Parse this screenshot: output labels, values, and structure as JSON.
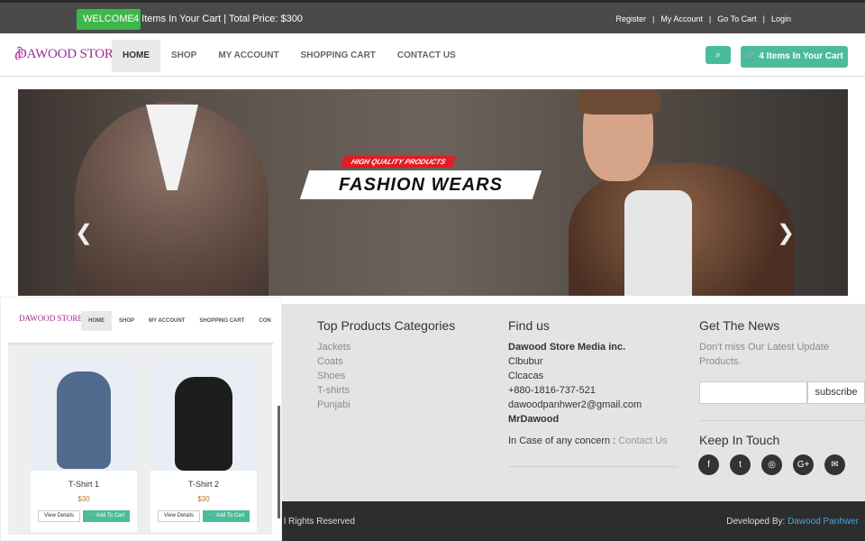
{
  "topbar": {
    "welcome": "WELCOME",
    "cart_summary": "4 Items In Your Cart | Total Price: $300",
    "links": [
      "Register",
      "My Account",
      "Go To Cart",
      "Login"
    ]
  },
  "logo": "DAWOOD STORE",
  "nav": [
    "HOME",
    "SHOP",
    "MY ACCOUNT",
    "SHOPPING CART",
    "CONTACT US"
  ],
  "header_cart": "4 Items In Your Cart",
  "hero": {
    "tag": "HIGH QUALITY PRODUCTS",
    "title": "FASHION WEARS"
  },
  "footer": {
    "categories_title": "Top Products Categories",
    "categories": [
      "Jackets",
      "Coats",
      "Shoes",
      "T-shirts",
      "Punjabi"
    ],
    "find_title": "Find us",
    "company": "Dawood Store Media inc.",
    "address": [
      "Clbubur",
      "Clcacas"
    ],
    "phone": "+880-1816-737-521",
    "email": "dawoodpanhwer2@gmail.com",
    "person": "MrDawood",
    "concern_text": "In Case of any concern : ",
    "concern_link": "Contact Us",
    "news_title": "Get The News",
    "news_text": "Don't miss Our Latest Update Products.",
    "subscribe": "subscribe",
    "touch_title": "Keep In Touch"
  },
  "bottom": {
    "rights": "l Rights Reserved",
    "developed": "Developed By:",
    "developer": "Dawood Panhwer"
  },
  "panel": {
    "logo": "DAWOOD STORE",
    "nav": [
      "HOME",
      "SHOP",
      "MY ACCOUNT",
      "SHOPPING CART",
      "CON"
    ],
    "products": [
      {
        "name": "T-Shirt 1",
        "price": "$30",
        "view": "View Details",
        "add": "Add To Cart"
      },
      {
        "name": "T-Shirt 2",
        "price": "$30",
        "view": "View Details",
        "add": "Add To Cart"
      }
    ]
  },
  "colors": {
    "accent": "#4bbc9a",
    "welcome": "#3db74b",
    "topbar": "#4a4a4a",
    "footer": "#e4e4e4",
    "bottom": "#2d2d2d"
  }
}
